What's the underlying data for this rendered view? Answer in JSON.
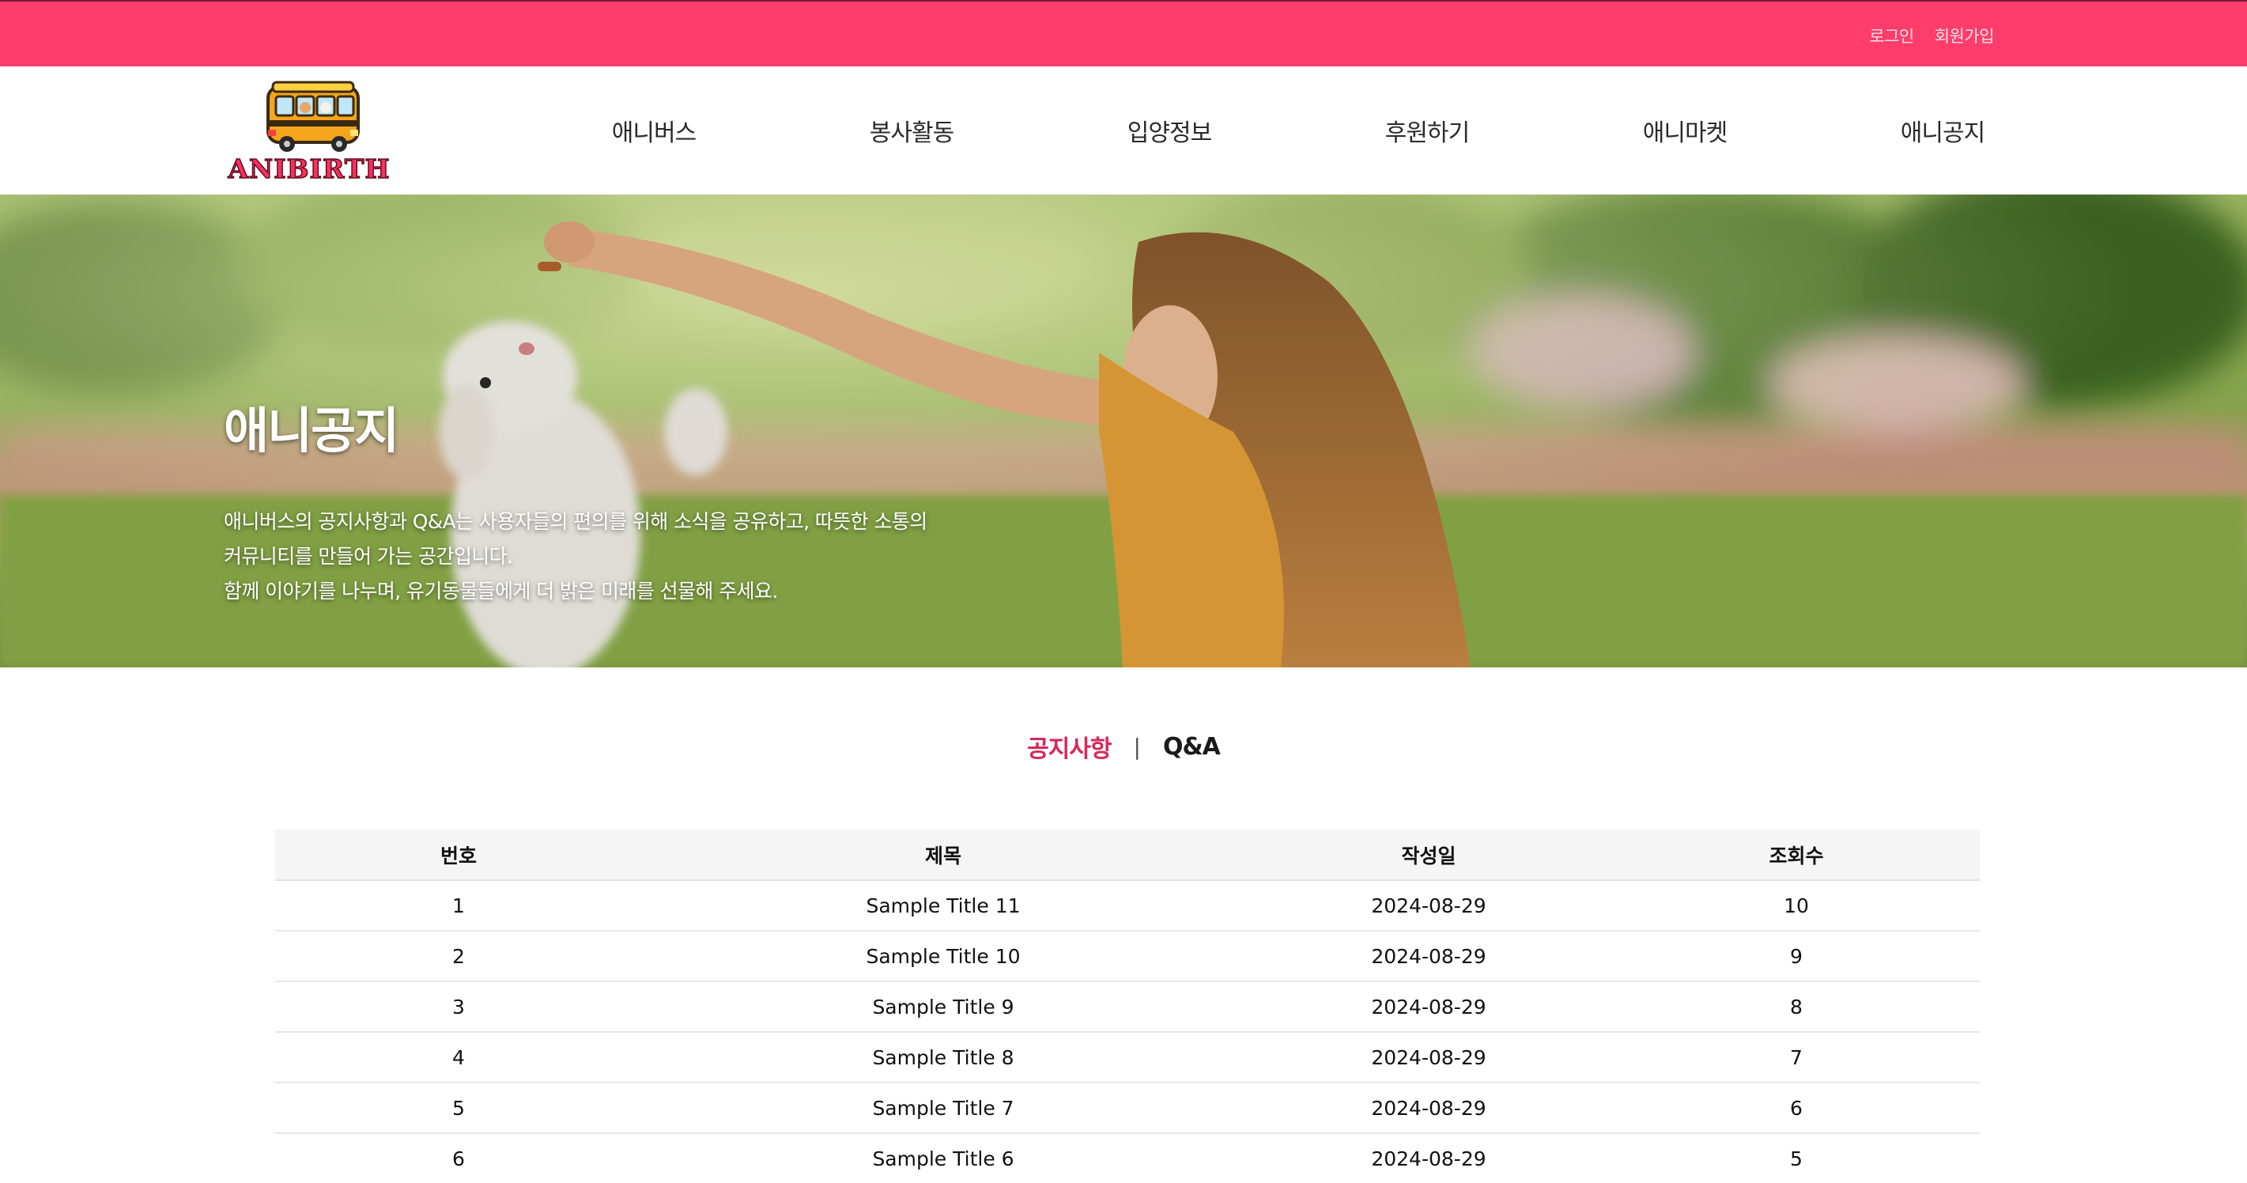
{
  "topbar": {
    "login": "로그인",
    "signup": "회원가입"
  },
  "header": {
    "logo_text": "ANIBIRTH",
    "nav": [
      "애니버스",
      "봉사활동",
      "입양정보",
      "후원하기",
      "애니마켓",
      "애니공지"
    ]
  },
  "hero": {
    "title": "애니공지",
    "desc_lines": [
      "애니버스의 공지사항과 Q&A는 사용자들의 편의를 위해 소식을 공유하고, 따뜻한 소통의",
      "커뮤니티를 만들어 가는 공간입니다.",
      "함께 이야기를 나누며, 유기동물들에게 더 밝은 미래를 선물해 주세요."
    ]
  },
  "tabs": {
    "notice": "공지사항",
    "divider": "|",
    "qa": "Q&A",
    "active_color": "#d42a5b"
  },
  "table": {
    "headers": [
      "번호",
      "제목",
      "작성일",
      "조회수"
    ],
    "rows": [
      [
        "1",
        "Sample Title 11",
        "2024-08-29",
        "10"
      ],
      [
        "2",
        "Sample Title 10",
        "2024-08-29",
        "9"
      ],
      [
        "3",
        "Sample Title 9",
        "2024-08-29",
        "8"
      ],
      [
        "4",
        "Sample Title 8",
        "2024-08-29",
        "7"
      ],
      [
        "5",
        "Sample Title 7",
        "2024-08-29",
        "6"
      ],
      [
        "6",
        "Sample Title 6",
        "2024-08-29",
        "5"
      ]
    ]
  },
  "colors": {
    "topbar": "#ff3d6a",
    "accent": "#d42a5b"
  }
}
